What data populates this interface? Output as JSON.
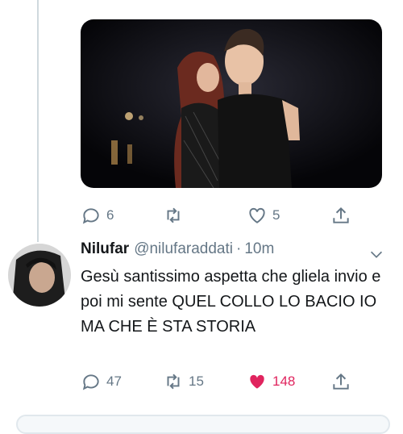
{
  "prev_tweet": {
    "stats": {
      "replies": "6",
      "retweets": "",
      "likes": "5"
    }
  },
  "tweet": {
    "display_name": "Nilufar",
    "handle": "@nilufaraddati",
    "separator": "·",
    "time": "10m",
    "text": "Gesù santissimo aspetta che gliela invio e poi mi sente QUEL COLLO LO BACIO IO MA CHE È STA STORIA",
    "stats": {
      "replies": "47",
      "retweets": "15",
      "likes": "148"
    }
  },
  "icons": [
    "reply-icon",
    "retweet-icon",
    "like-icon",
    "share-icon",
    "chevron-down-icon"
  ],
  "colors": {
    "like_active": "#e0245e",
    "muted": "#657786",
    "thread_line": "#cfd9de"
  }
}
